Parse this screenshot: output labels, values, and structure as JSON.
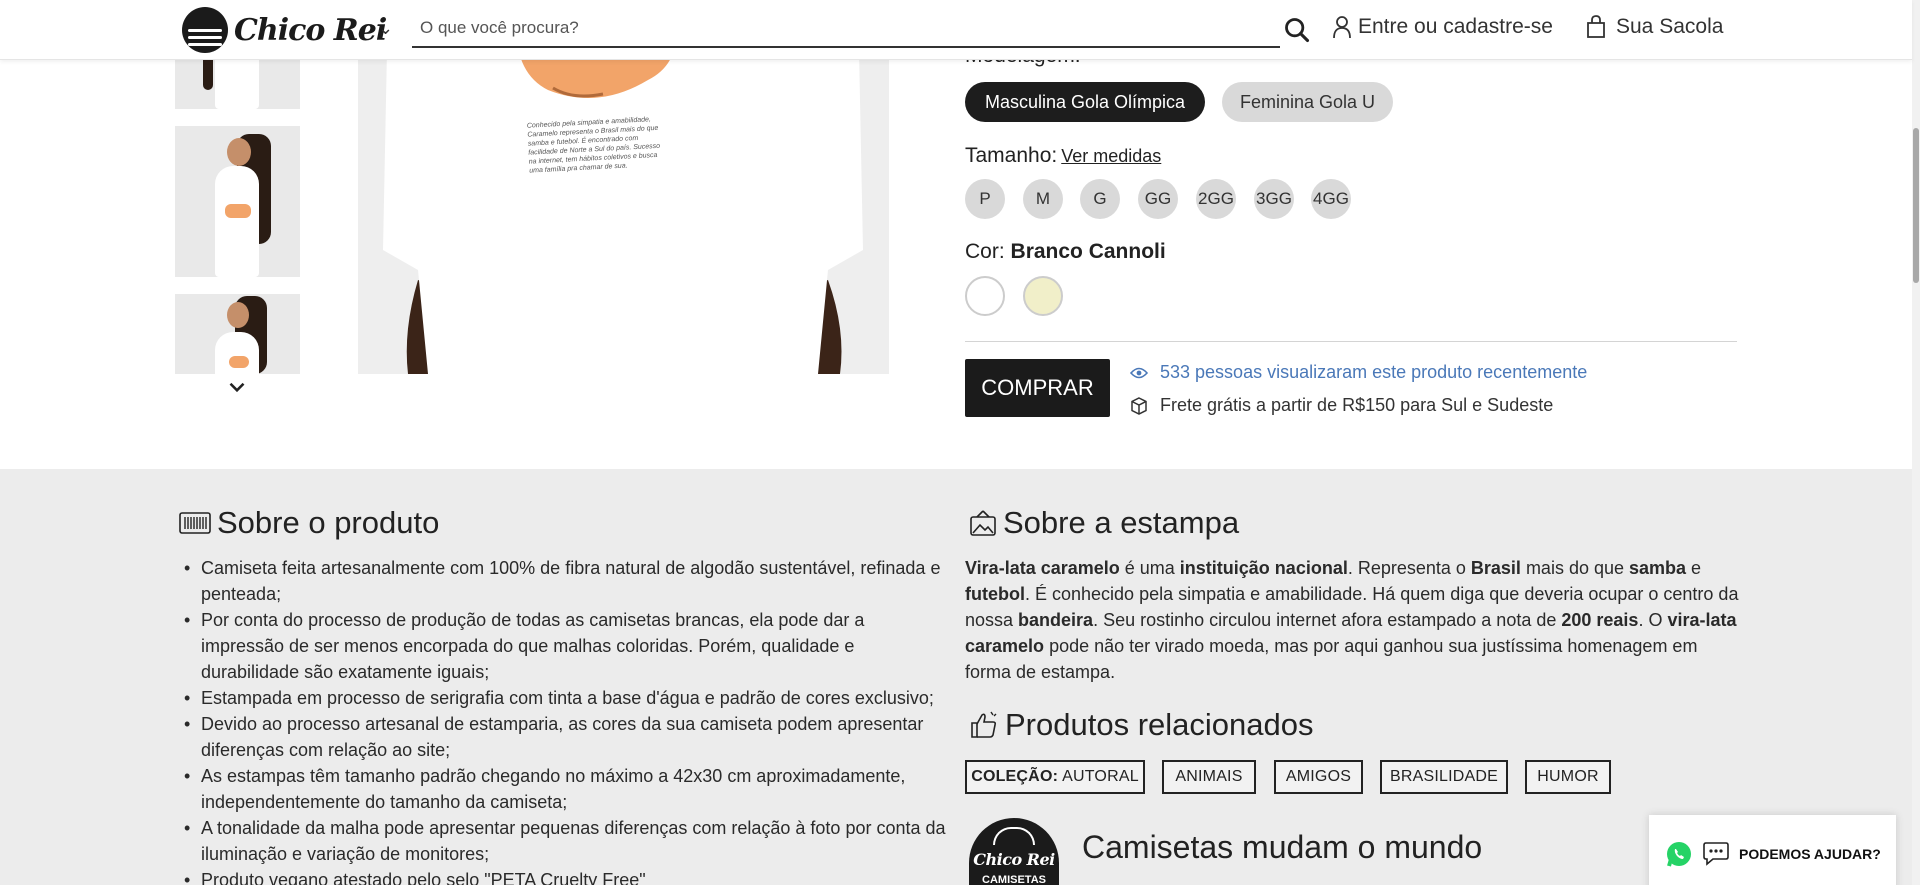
{
  "header": {
    "logo_text": "Chico Rei",
    "search_placeholder": "O que você procura?",
    "account_label": "Entre ou cadastre-se",
    "bag_label": "Sua Sacola"
  },
  "product_text_on_shirt": "Conhecido pela simpatia e amabilidade, Caramelo representa o Brasil mais do que samba e futebol. É encontrado com facilidade de Norte a Sul do país. Sucesso na internet, tem hábitos coletivos e busca uma família pra chamar de sua.",
  "options": {
    "modelagem_label": "Modelagem:",
    "modelagem": [
      "Masculina Gola Olímpica",
      "Feminina Gola U"
    ],
    "modelagem_selected": "Masculina Gola Olímpica",
    "tamanho_label": "Tamanho:",
    "ver_medidas": "Ver medidas",
    "sizes": [
      "P",
      "M",
      "G",
      "GG",
      "2GG",
      "3GG",
      "4GG"
    ],
    "cor_label": "Cor:",
    "cor_value": "Branco Cannoli",
    "swatch_colors": [
      "#ffffff",
      "#f1efc9"
    ]
  },
  "purchase": {
    "buy_label": "COMPRAR",
    "views_text": "533 pessoas visualizaram este produto recentemente",
    "shipping_text": "Frete grátis a partir de R$150 para Sul e Sudeste",
    "views_color": "#4a78b8"
  },
  "sobre_produto": {
    "title": "Sobre o produto",
    "items": [
      "Camiseta feita artesanalmente com 100% de fibra natural de algodão sustentável, refinada e penteada;",
      "Por conta do processo de produção de todas as camisetas brancas, ela pode dar a impressão de ser menos encorpada do que malhas coloridas. Porém, qualidade e durabilidade são exatamente iguais;",
      "Estampada em processo de serigrafia com tinta a base d'água e padrão de cores exclusivo;",
      "Devido ao processo artesanal de estamparia, as cores da sua camiseta podem apresentar diferenças com relação ao site;",
      "As estampas têm tamanho padrão chegando no máximo a 42x30 cm aproximadamente, independentemente do tamanho da camiseta;",
      "A tonalidade da malha pode apresentar pequenas diferenças com relação à foto por conta da iluminação e variação de monitores;",
      "Produto vegano atestado pelo selo \"PETA Cruelty Free\""
    ]
  },
  "sobre_estampa": {
    "title": "Sobre a estampa",
    "parts": [
      {
        "b": "Vira-lata caramelo"
      },
      {
        "t": " é uma "
      },
      {
        "b": "instituição nacional"
      },
      {
        "t": ". Representa o "
      },
      {
        "b": "Brasil"
      },
      {
        "t": " mais do que "
      },
      {
        "b": "samba"
      },
      {
        "t": " e "
      },
      {
        "b": "futebol"
      },
      {
        "t": ". É conhecido pela simpatia e amabilidade. Há quem diga que deveria ocupar o centro da nossa "
      },
      {
        "b": "bandeira"
      },
      {
        "t": ". Seu rostinho circulou internet afora estampado a nota de "
      },
      {
        "b": "200 reais"
      },
      {
        "t": ". O "
      },
      {
        "b": "vira-lata caramelo"
      },
      {
        "t": " pode não ter virado moeda, mas por aqui ganhou sua justíssima homenagem em forma de estampa."
      }
    ]
  },
  "relacionados": {
    "title": "Produtos relacionados",
    "colecao_label": "COLEÇÃO:",
    "tags": [
      "AUTORAL",
      "ANIMAIS",
      "AMIGOS",
      "BRASILIDADE",
      "HUMOR"
    ]
  },
  "mundo": {
    "badge_line1": "Chico Rei",
    "badge_line2": "CAMISETAS",
    "title": "Camisetas mudam o mundo"
  },
  "help_label": "PODEMOS AJUDAR?"
}
